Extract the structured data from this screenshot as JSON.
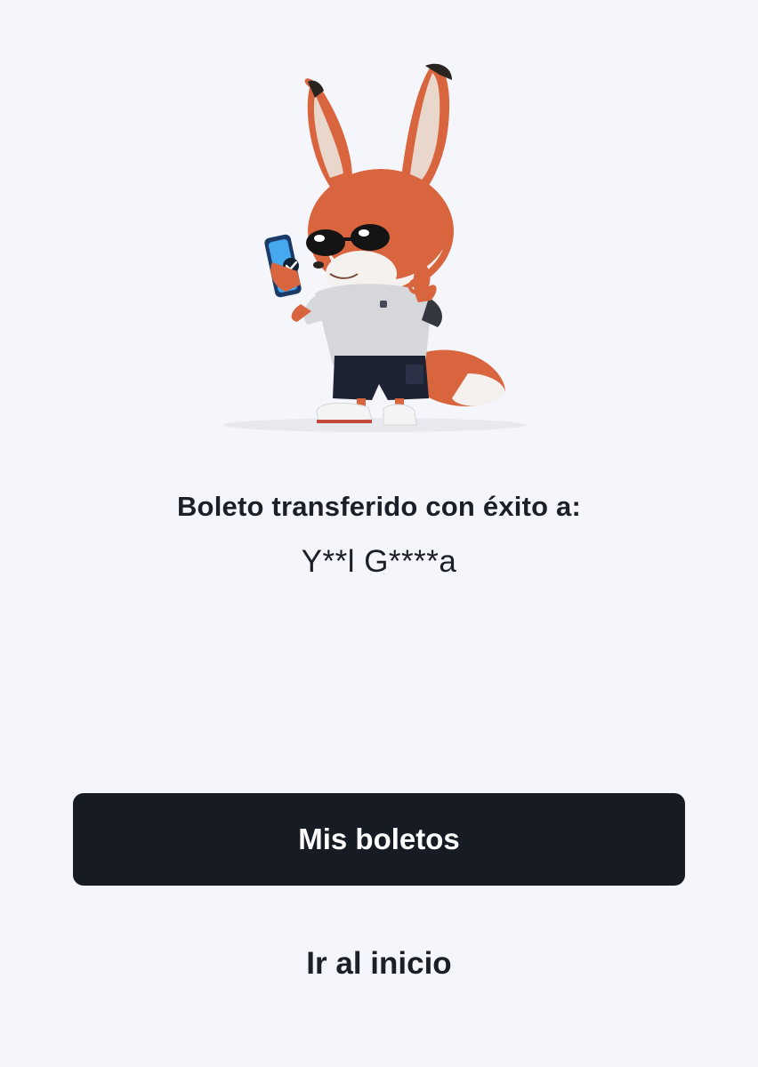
{
  "screen": {
    "background_color": "#f4f6fb"
  },
  "illustration": {
    "name": "fox-mascot-holding-phone",
    "phone_icon": "check-icon"
  },
  "message": {
    "title": "Boleto transferido con éxito a:",
    "recipient": "Y**l G****a"
  },
  "actions": {
    "primary_label": "Mis boletos",
    "primary_color": "#171b24",
    "secondary_label": "Ir al inicio"
  }
}
